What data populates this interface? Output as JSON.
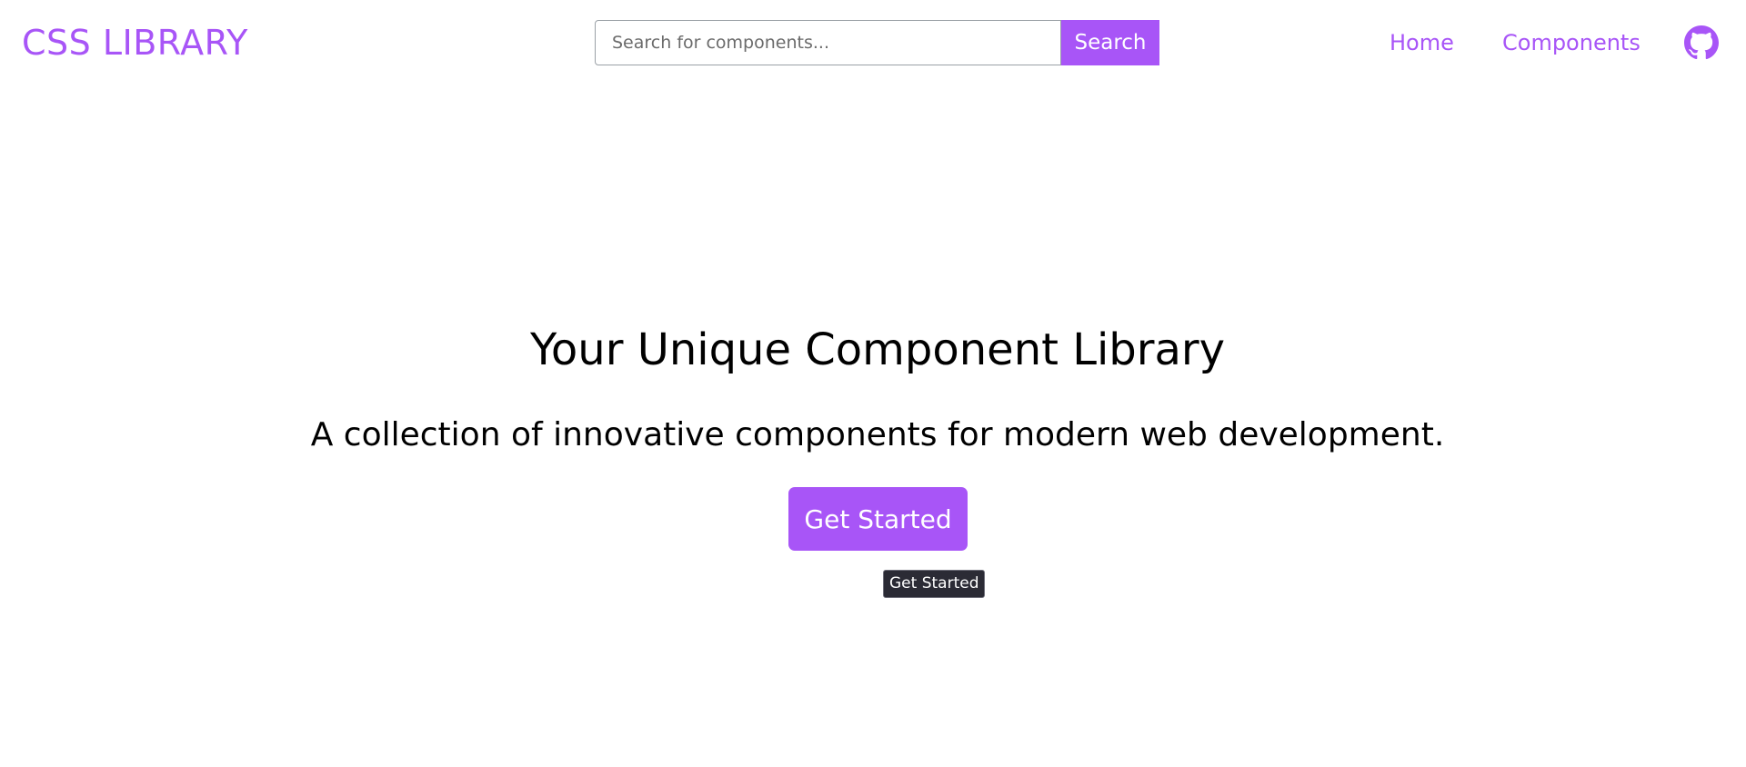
{
  "header": {
    "logo": "CSS LIBRARY",
    "search": {
      "placeholder": "Search for components...",
      "value": "",
      "button_label": "Search"
    },
    "nav": [
      {
        "label": "Home"
      },
      {
        "label": "Components"
      }
    ],
    "github_icon": "github-icon"
  },
  "hero": {
    "title": "Your Unique Component Library",
    "subtitle": "A collection of innovative components for modern web development.",
    "cta_label": "Get Started",
    "tooltip": "Get Started"
  },
  "colors": {
    "accent": "#a855f7",
    "text": "#000000",
    "background": "#ffffff",
    "tooltip_bg": "#2b2b35"
  }
}
